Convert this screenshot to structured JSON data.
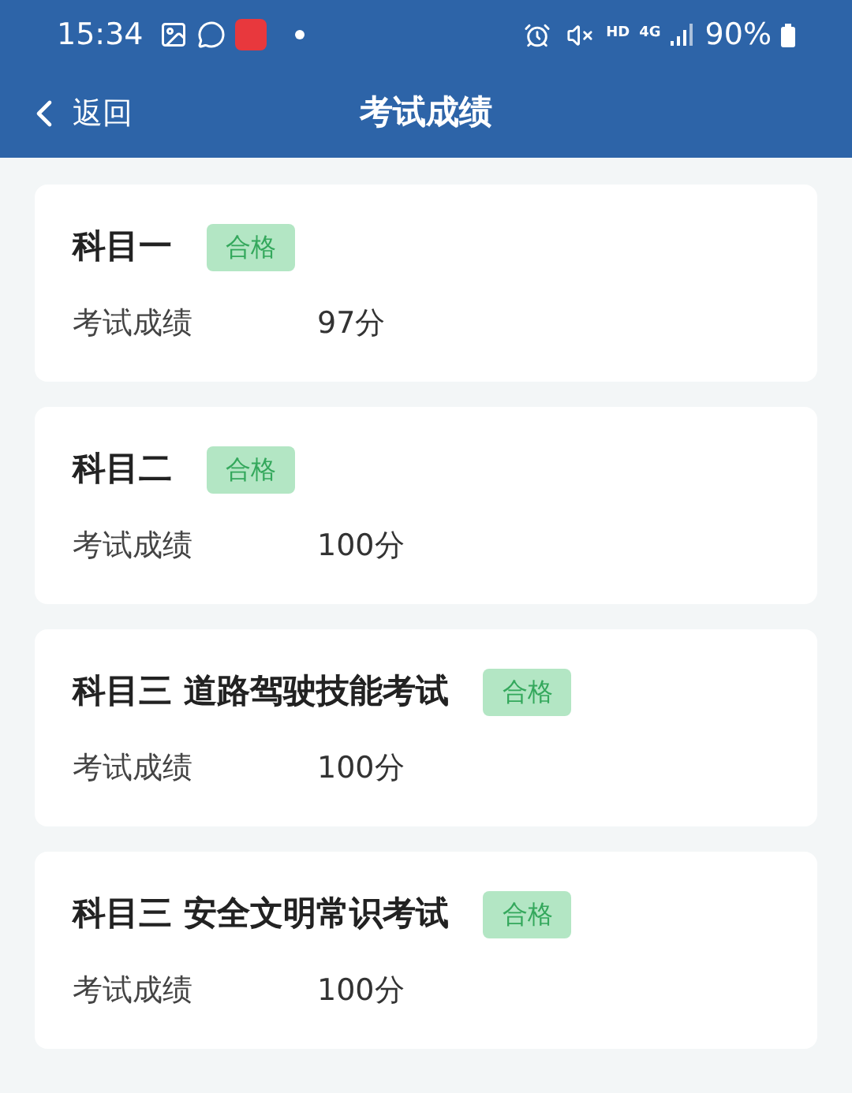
{
  "status_bar": {
    "time": "15:34",
    "hd": "HD",
    "network": "4G",
    "battery": "90%"
  },
  "nav": {
    "back": "返回",
    "title": "考试成绩"
  },
  "results": [
    {
      "subject": "科目一",
      "badge": "合格",
      "passed": true,
      "label": "考试成绩",
      "score": "97分"
    },
    {
      "subject": "科目二",
      "badge": "合格",
      "passed": true,
      "label": "考试成绩",
      "score": "100分"
    },
    {
      "subject": "科目三 道路驾驶技能考试",
      "badge": "合格",
      "passed": true,
      "label": "考试成绩",
      "score": "100分"
    },
    {
      "subject": "科目三 安全文明常识考试",
      "badge": "合格",
      "passed": true,
      "label": "考试成绩",
      "score": "100分"
    }
  ]
}
